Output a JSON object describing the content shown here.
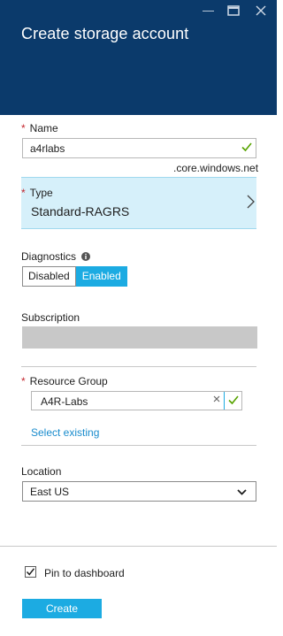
{
  "window": {
    "title": "Create storage account",
    "minimize_icon": "minimize-icon",
    "maximize_icon": "maximize-icon",
    "close_icon": "close-icon"
  },
  "name_field": {
    "required_mark": "*",
    "label": "Name",
    "value": "a4rlabs",
    "suffix": ".core.windows.net",
    "valid_icon": "checkmark-icon"
  },
  "type_field": {
    "required_mark": "*",
    "label": "Type",
    "value": "Standard-RAGRS",
    "chevron_icon": "chevron-right-icon"
  },
  "diagnostics": {
    "label": "Diagnostics",
    "info_icon": "info-icon",
    "options": [
      "Disabled",
      "Enabled"
    ],
    "selected": "Enabled"
  },
  "subscription": {
    "label": "Subscription",
    "value": ""
  },
  "resource_group": {
    "required_mark": "*",
    "label": "Resource Group",
    "value": "A4R-Labs",
    "clear_icon": "clear-icon",
    "valid_icon": "checkmark-icon",
    "select_existing_link": "Select existing"
  },
  "location": {
    "label": "Location",
    "value": "East US",
    "chevron_icon": "chevron-down-icon"
  },
  "footer": {
    "pin_label": "Pin to dashboard",
    "pin_checked": true,
    "create_label": "Create"
  },
  "colors": {
    "header_bg": "#0b3a6b",
    "accent": "#1cabe2",
    "required": "#c4262e",
    "valid": "#57a300",
    "link": "#1a8ccd",
    "type_panel_bg": "#d6f0fa"
  }
}
